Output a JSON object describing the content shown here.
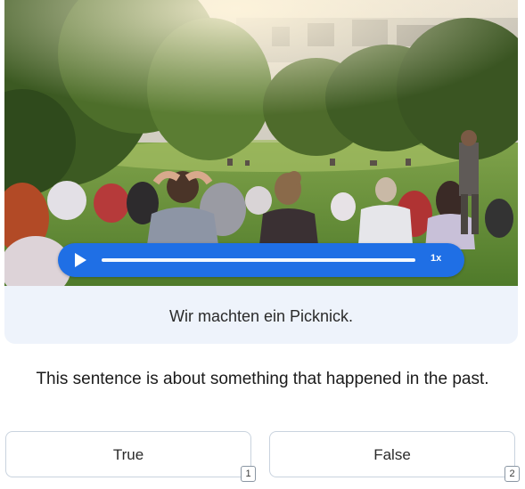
{
  "exercise": {
    "photo_alt": "people-picnic-in-park-photo",
    "audio": {
      "speed_label": "1x",
      "progress": 0.0
    },
    "sentence": "Wir machten ein Picknick.",
    "question": "This sentence is about something that happened in the past.",
    "answers": [
      {
        "label": "True",
        "shortcut": "1"
      },
      {
        "label": "False",
        "shortcut": "2"
      }
    ]
  },
  "colors": {
    "accent": "#1f6fe5",
    "card_bg": "#eef3fb",
    "button_border": "#c9d3de"
  },
  "icons": {
    "play": "play-icon"
  }
}
